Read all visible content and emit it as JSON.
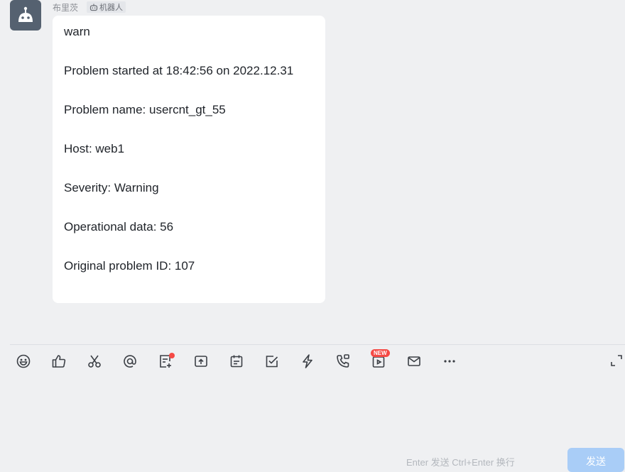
{
  "sender": {
    "name": "布里茨",
    "tag": "机器人"
  },
  "message": {
    "lines": [
      "warn",
      "Problem started at 18:42:56 on 2022.12.31",
      "Problem name: usercnt_gt_55",
      "Host: web1",
      "Severity: Warning",
      "Operational data: 56",
      "Original problem ID: 107"
    ]
  },
  "toolbar": {
    "icons": [
      "emoji-icon",
      "thumbs-up-icon",
      "scissors-icon",
      "at-icon",
      "note-icon",
      "upload-folder-icon",
      "calendar-icon",
      "task-check-icon",
      "lightning-icon",
      "phone-icon",
      "video-icon",
      "mail-icon",
      "more-icon"
    ],
    "new_badge": "NEW"
  },
  "composer": {
    "hint": "Enter 发送  Ctrl+Enter 换行",
    "send_label": "发送"
  },
  "colors": {
    "accent_disabled": "#a9cdf7",
    "badge_red": "#f54a45",
    "avatar_bg": "#556170"
  }
}
